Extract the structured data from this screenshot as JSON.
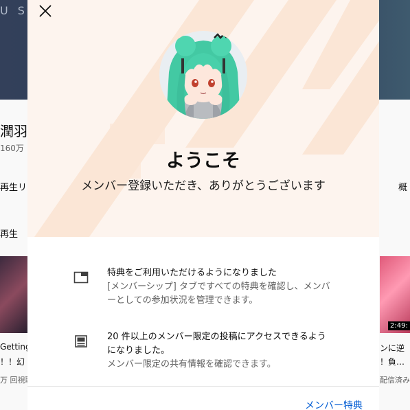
{
  "background": {
    "banner_left_text": "US",
    "banner_right_text": "R",
    "channel_title": "潤羽",
    "subscribers": "160万",
    "row1_left": "再生リ",
    "row1_right": "概",
    "row2_left": "再生",
    "video_left_duration": "",
    "video_right_duration": "2:49:",
    "video_left_title_1": "Getting",
    "video_left_title_2": "！！幻",
    "video_left_meta": "万 回視聴",
    "video_right_title_1": "ンに逆",
    "video_right_title_2": "！負…",
    "video_right_meta": "配信済み"
  },
  "dialog": {
    "heading": "ようこそ",
    "subheading": "メンバー登録いただき、ありがとうございます",
    "benefits": [
      {
        "icon": "tab-window-icon",
        "title": "特典をご利用いただけるようになりました",
        "description": "[メンバーシップ] タブですべての特典を確認し、メンバーとしての参加状況を管理できます。"
      },
      {
        "icon": "posts-icon",
        "title": "20 件以上のメンバー限定の投稿にアクセスできるようになりました。",
        "description": "メンバー限定の共有情報を確認できます。"
      }
    ],
    "footer_link": "メンバー特典"
  },
  "colors": {
    "hero_bg": "#fdf4ee",
    "hero_stripe": "#fbe6d6",
    "link": "#065fd4",
    "avatar_hair": "#3fd0a8"
  }
}
